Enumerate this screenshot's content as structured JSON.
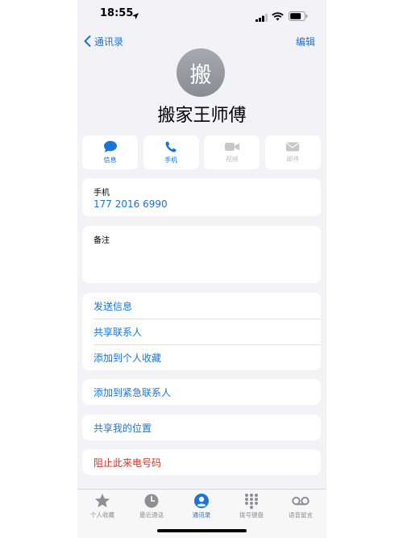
{
  "status_bar": {
    "time": "18:55"
  },
  "nav": {
    "back_label": "通讯录",
    "edit_label": "编辑"
  },
  "contact": {
    "avatar_initial": "搬",
    "name": "搬家王师傅"
  },
  "actions": [
    {
      "label": "信息",
      "icon": "message-icon",
      "enabled": true
    },
    {
      "label": "手机",
      "icon": "phone-icon",
      "enabled": true
    },
    {
      "label": "视频",
      "icon": "video-icon",
      "enabled": false
    },
    {
      "label": "邮件",
      "icon": "mail-icon",
      "enabled": false
    }
  ],
  "phone_field": {
    "label": "手机",
    "number": "177 2016 6990"
  },
  "notes_field": {
    "label": "备注"
  },
  "options_group1": [
    "发送信息",
    "共享联系人",
    "添加到个人收藏"
  ],
  "emergency": "添加到紧急联系人",
  "share_location": "共享我的位置",
  "block": "阻止此来电号码",
  "tabs": [
    {
      "label": "个人收藏",
      "icon": "star-icon",
      "active": false
    },
    {
      "label": "最近通话",
      "icon": "clock-icon",
      "active": false
    },
    {
      "label": "通讯录",
      "icon": "contacts-icon",
      "active": true
    },
    {
      "label": "拨号键盘",
      "icon": "keypad-icon",
      "active": false
    },
    {
      "label": "语音留言",
      "icon": "voicemail-icon",
      "active": false
    }
  ],
  "colors": {
    "accent": "#1a73d8",
    "destructive": "#d93025",
    "background": "#f2f2f7"
  }
}
